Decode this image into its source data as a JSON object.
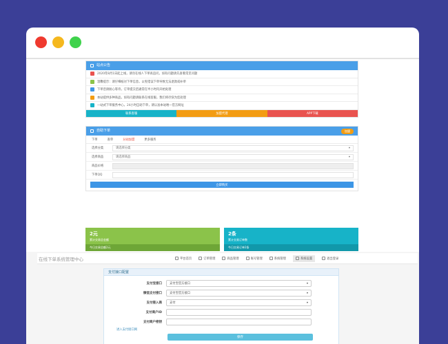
{
  "colors": {
    "background": "#3b3f97",
    "panel_header": "#4a9fe8",
    "green": "#8bc34a",
    "teal": "#17b3c8",
    "orange": "#f39c12",
    "red": "#e9534f"
  },
  "notice": {
    "title": "站点公告",
    "items": [
      {
        "text": "2020年8月1日起上线，请勿在线人下单再追问，如有问题请先查看常见问题",
        "color": "#e9534f"
      },
      {
        "text": "温馨提示：请仔细核对下单信息，以免错误下单导致无法退款或补单",
        "color": "#8bc34a"
      },
      {
        "text": "下单后请耐心等待，订单提交后通常在半小时内开始处理",
        "color": "#3d96e6"
      },
      {
        "text": "本站提供多种商品，如有问题请联系在线客服，我们将尽快为您处理",
        "color": "#f39c12"
      },
      {
        "text": "一站式下单服务中心，24小时自助下单，请认准本站唯一官方网址",
        "color": "#17b3c8"
      }
    ],
    "buttons": [
      {
        "label": "联系客服",
        "color": "#17b3c8"
      },
      {
        "label": "加盟代理",
        "color": "#f39c12"
      },
      {
        "label": "APP下载",
        "color": "#e9534f"
      }
    ]
  },
  "order": {
    "title": "自助下单",
    "pill": "加盟",
    "tabs": [
      "下单",
      "查单",
      "分站加盟",
      "更多服务"
    ],
    "fields": [
      {
        "label": "选择分类",
        "value": "请选择分类",
        "grey": false
      },
      {
        "label": "选择商品",
        "value": "请选择商品",
        "grey": false
      },
      {
        "label": "商品价格",
        "value": "",
        "grey": true
      },
      {
        "label": "下单QQ",
        "value": "",
        "grey": false
      }
    ],
    "submit": "立即购买"
  },
  "stats": [
    {
      "big": "2元",
      "small": "累计交易总金额",
      "foot": "今日交易总额2元",
      "color": "#8bc34a",
      "foot_color": "#6ea637"
    },
    {
      "big": "2条",
      "small": "累计交易订单数",
      "foot": "今日交易订单2条",
      "color": "#17b3c8",
      "foot_color": "#1198aa"
    }
  ],
  "admin": {
    "brand": "在线下单系统管理中心",
    "nav": [
      "平台首页",
      "订单管理",
      "商品管理",
      "账号管理",
      "系统管理",
      "系统设置",
      "退出登录"
    ],
    "form_title": "支付接口配置",
    "rows": [
      {
        "label": "支付宝接口",
        "value": "支付宝官方接口"
      },
      {
        "label": "微信支付接口",
        "value": "支付宝官方接口"
      },
      {
        "label": "支付接入商",
        "value": "支付"
      },
      {
        "label": "支付商户ID",
        "value": ""
      },
      {
        "label": "支付商户密钥",
        "value": ""
      }
    ],
    "link": "进入支付接口网",
    "save": "保存"
  }
}
